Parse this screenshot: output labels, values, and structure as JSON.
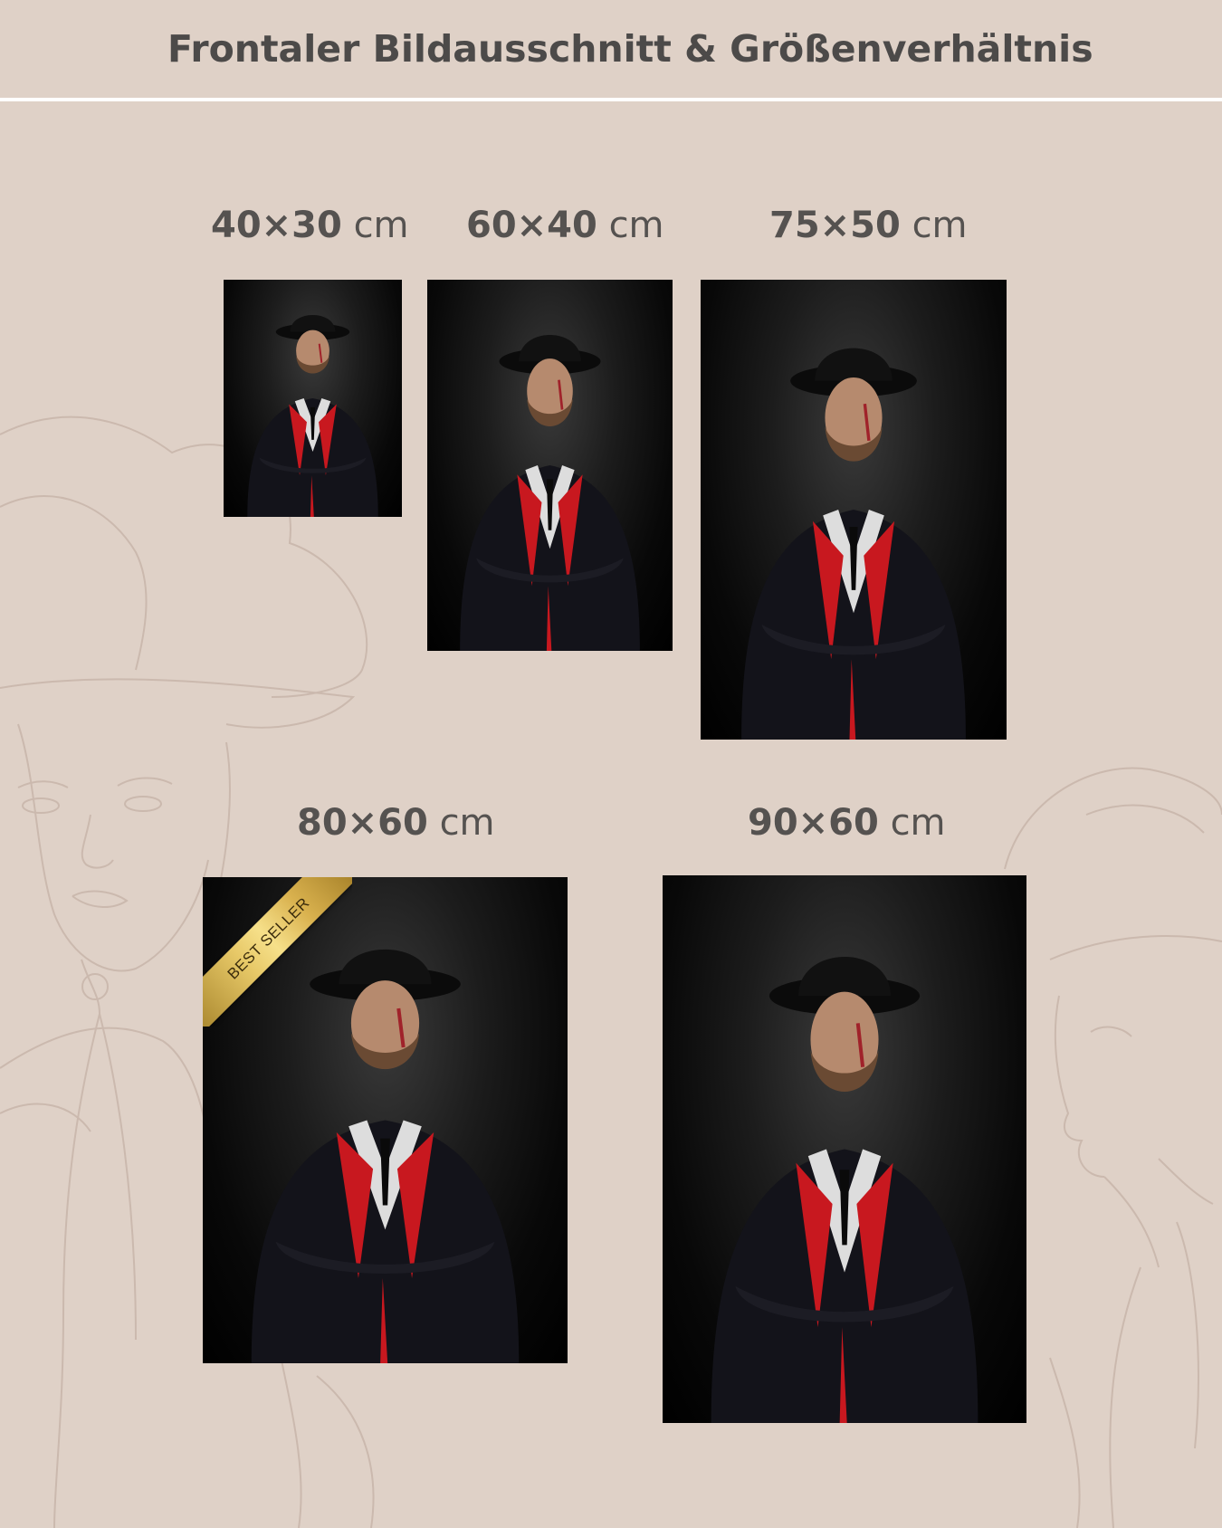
{
  "header": {
    "title": "Frontaler Bildausschnitt & Größenverhältnis"
  },
  "sizes": [
    {
      "dims": "40×30",
      "unit": "cm"
    },
    {
      "dims": "60×40",
      "unit": "cm"
    },
    {
      "dims": "75×50",
      "unit": "cm"
    },
    {
      "dims": "80×60",
      "unit": "cm",
      "badge": "BEST SELLER"
    },
    {
      "dims": "90×60",
      "unit": "cm"
    }
  ],
  "colors": {
    "background": "#dfd1c7",
    "title": "#4c4a49",
    "badge_gold": "#e7c867",
    "coat_red": "#c8181f"
  }
}
